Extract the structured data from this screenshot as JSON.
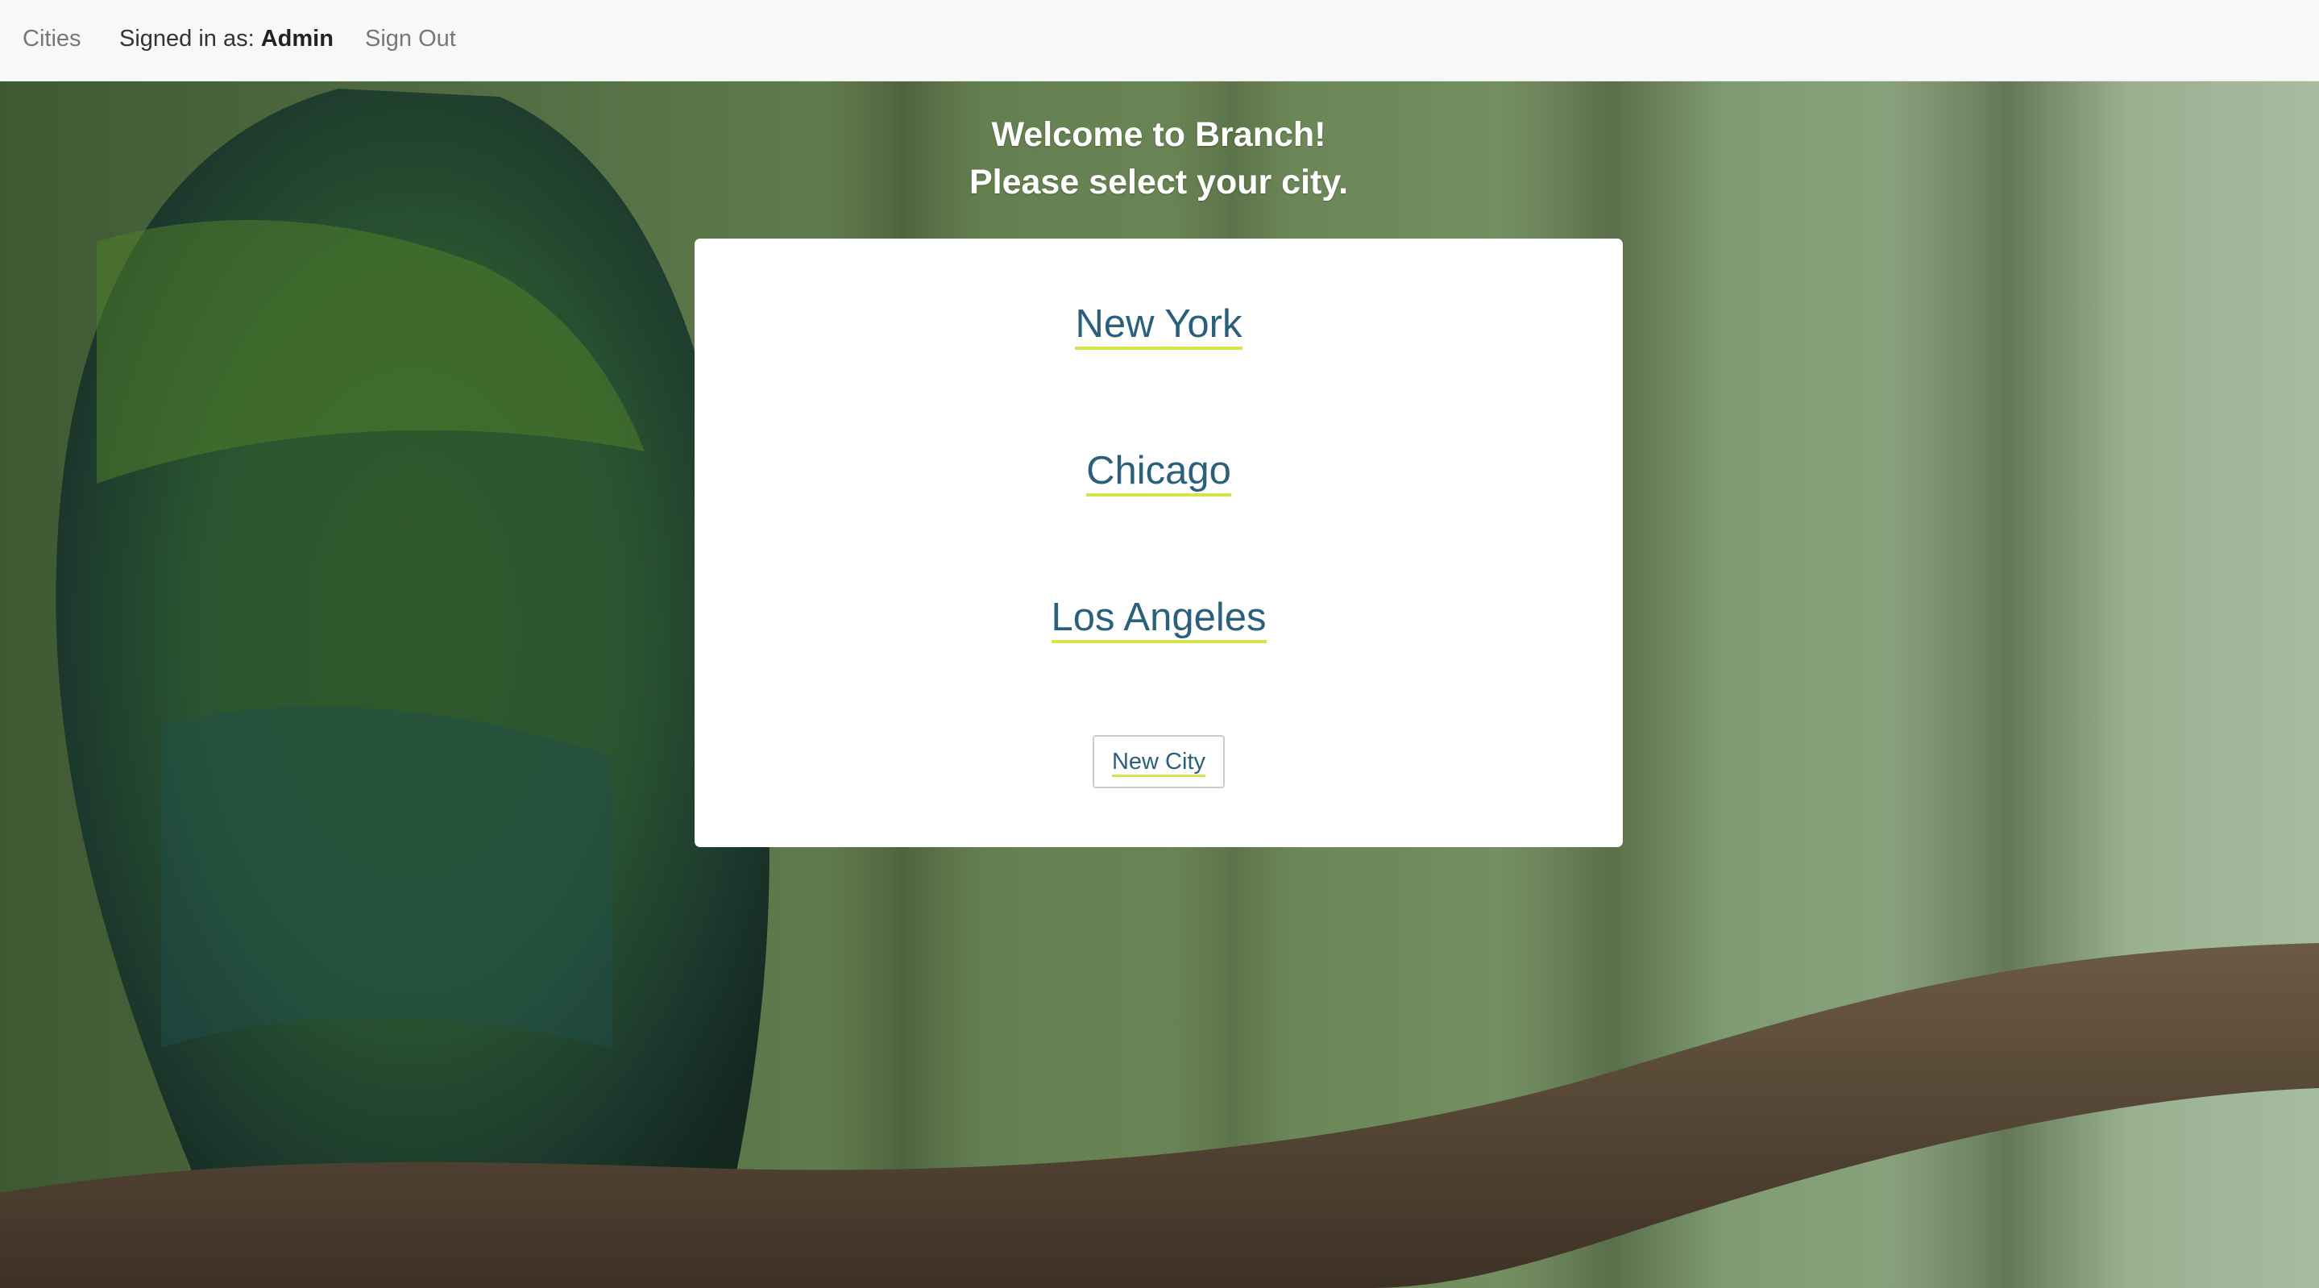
{
  "navbar": {
    "cities_label": "Cities",
    "signed_in_prefix": "Signed in as:",
    "signed_in_user": "Admin",
    "sign_out_label": "Sign Out"
  },
  "welcome": {
    "line1": "Welcome to Branch!",
    "line2": "Please select your city."
  },
  "cities": [
    {
      "name": "New York"
    },
    {
      "name": "Chicago"
    },
    {
      "name": "Los Angeles"
    }
  ],
  "new_city_label": "New City",
  "colors": {
    "link": "#2a6079",
    "link_underline": "#d6e34a",
    "navbar_bg": "#f8f8f8"
  }
}
